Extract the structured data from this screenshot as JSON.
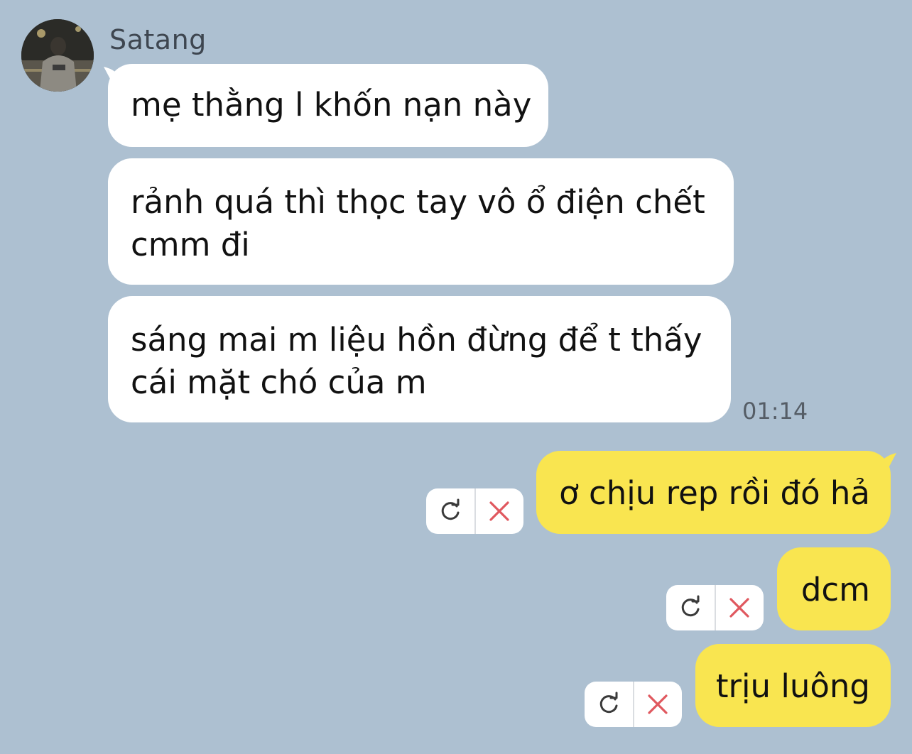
{
  "conversation": {
    "sender_name": "Satang",
    "incoming": [
      {
        "text": "mẹ thằng l khốn nạn này"
      },
      {
        "line1": "rảnh quá thì thọc tay vô ổ điện chết",
        "line2": "cmm đi"
      },
      {
        "line1": "sáng mai m liệu hồn đừng để t thấy",
        "line2": "cái mặt chó của m"
      }
    ],
    "timestamp": "01:14",
    "outgoing": [
      {
        "text": "ơ chịu rep rồi đó hả",
        "status": "failed"
      },
      {
        "text": "dcm",
        "status": "failed"
      },
      {
        "text": "trịu luông",
        "status": "failed"
      }
    ]
  },
  "icons": {
    "avatar": "profile-photo",
    "retry": "retry-icon",
    "delete": "delete-icon"
  },
  "colors": {
    "background": "#adc0d1",
    "incoming_bubble": "#ffffff",
    "outgoing_bubble": "#f9e550",
    "delete_icon": "#e0585f",
    "retry_icon": "#3a3a3a"
  }
}
